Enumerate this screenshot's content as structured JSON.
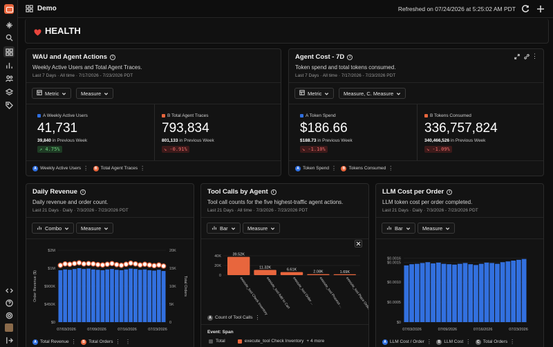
{
  "app": {
    "title": "Demo",
    "refreshed": "Refreshed on 07/24/2026 at 5:25:02 AM PDT"
  },
  "dashboard": {
    "section_title": "HEALTH"
  },
  "wau": {
    "title": "WAU and Agent Actions",
    "desc": "Weekly Active Users and Total Agent Traces.",
    "meta": "Last 7 Days · All time · 7/17/2026 - 7/23/2026 PDT",
    "btn_metric": "Metric",
    "btn_measure": "Measure",
    "a_label": "A Weekly Active Users",
    "a_value": "41,731",
    "a_prev_num": "39,840",
    "a_prev_text": " in Previous Week",
    "a_delta": "↗ 4.75%",
    "b_label": "B Total Agent Traces",
    "b_value": "793,834",
    "b_prev_num": "801,133",
    "b_prev_text": " in Previous Week",
    "b_delta": "↘ -0.91%",
    "legend_a": "Weekly Active Users",
    "legend_b": "Total Agent Traces"
  },
  "cost": {
    "title": "Agent Cost - 7D",
    "desc": "Token spend and total tokens consumed.",
    "meta": "Last 7 Days · All time · 7/17/2026 - 7/23/2026 PDT",
    "btn_metric": "Metric",
    "btn_measure": "Measure, C. Measure",
    "a_label": "A Token Spend",
    "a_value": "$186.66",
    "a_prev_num": "$188.73",
    "a_prev_text": " in Previous Week",
    "a_delta": "↘ -1.10%",
    "b_label": "B Tokens Consumed",
    "b_value": "336,757,824",
    "b_prev_num": "340,466,526",
    "b_prev_text": " in Previous Week",
    "b_delta": "↘ -1.09%",
    "legend_a": "Token Spend",
    "legend_b": "Tokens Consumed"
  },
  "revenue": {
    "title": "Daily Revenue",
    "desc": "Daily revenue and order count.",
    "meta": "Last 21 Days · Daily · 7/3/2026 - 7/23/2026 PDT",
    "btn_type": "Combo",
    "btn_measure": "Measure",
    "legend_a": "Total Revenue",
    "legend_b": "Total Orders",
    "y_left_title": "Order Revenue ($)",
    "y_right_title": "Total Orders"
  },
  "toolcalls": {
    "title": "Tool Calls by Agent",
    "desc": "Tool call counts for the five highest-traffic agent actions.",
    "meta": "Last 21 Days · All time · 7/3/2026 - 7/23/2026 PDT",
    "btn_type": "Bar",
    "btn_measure": "Measure",
    "legend_a": "Count of Tool Calls",
    "event_label": "Event: Span",
    "event_total": "Total",
    "event_item": "execute_tool Check Inventory",
    "event_more": "+ 4 more"
  },
  "llmcost": {
    "title": "LLM Cost per Order",
    "desc": "LLM token cost per order completed.",
    "meta": "Last 21 Days · Daily · 7/3/2026 - 7/23/2026 PDT",
    "btn_type": "Bar",
    "btn_measure": "Measure",
    "legend_a": "LLM Cost / Order",
    "legend_b": "LLM Cost",
    "legend_c": "Total Orders"
  },
  "colors": {
    "blue": "#2f6fe0",
    "orange": "#e8663d",
    "bar_blue": "#3270df"
  },
  "chart_data": [
    {
      "type": "combo",
      "title": "Daily Revenue",
      "ylabel": "Order Revenue ($)",
      "y2label": "Total Orders",
      "ylim": [
        0,
        1800000
      ],
      "y2lim": [
        0,
        20000
      ],
      "y_ticks": [
        "$0",
        "$450K",
        "$900K",
        "$1M",
        "$2M"
      ],
      "y2_ticks": [
        "0",
        "5K",
        "10K",
        "15K",
        "20K"
      ],
      "x_ticks": [
        "07/03/2026",
        "07/09/2026",
        "07/16/2026",
        "07/23/2026"
      ],
      "series": [
        {
          "name": "Total Revenue",
          "type": "bar",
          "values": [
            1300000,
            1320000,
            1310000,
            1330000,
            1350000,
            1330000,
            1340000,
            1320000,
            1310000,
            1300000,
            1320000,
            1330000,
            1310000,
            1300000,
            1320000,
            1340000,
            1330000,
            1310000,
            1320000,
            1300000,
            1290000,
            1310000,
            1280000
          ]
        },
        {
          "name": "Total Orders",
          "type": "line",
          "values": [
            15800,
            16200,
            16100,
            16300,
            16500,
            16200,
            16300,
            16200,
            16000,
            15900,
            16100,
            16300,
            16000,
            15800,
            16100,
            16400,
            16200,
            15900,
            16100,
            15900,
            15700,
            15900,
            15600
          ]
        }
      ]
    },
    {
      "type": "bar",
      "title": "Tool Calls by Agent",
      "categories": [
        "execute_tool Check Inventory",
        "execute_tool Add to Cart",
        "execute_tool Order ...",
        "execute_tool Process ...",
        "execute_tool Place Order"
      ],
      "values": [
        39520,
        11320,
        6610,
        2080,
        1690
      ],
      "data_labels": [
        "39.52K",
        "11.32K",
        "6.61K",
        "2.08K",
        "1.69K"
      ],
      "y_ticks": [
        "0",
        "20K",
        "40K"
      ],
      "ylim": [
        0,
        45000
      ]
    },
    {
      "type": "bar",
      "title": "LLM Cost per Order",
      "ylim": [
        0,
        0.0018
      ],
      "y_ticks": [
        "$0",
        "$0.0005",
        "$0.0010",
        "$0.0015",
        "$0.0016"
      ],
      "x_ticks": [
        "07/03/2026",
        "07/09/2026",
        "07/16/2026",
        "07/23/2026"
      ],
      "series": [
        {
          "name": "LLM Cost / Order",
          "values": [
            0.00142,
            0.00145,
            0.00146,
            0.00148,
            0.0015,
            0.00147,
            0.00149,
            0.00146,
            0.00145,
            0.00144,
            0.00146,
            0.00148,
            0.00145,
            0.00143,
            0.00146,
            0.00149,
            0.00148,
            0.00146,
            0.0015,
            0.00152,
            0.00154,
            0.00156,
            0.00158
          ]
        }
      ]
    }
  ]
}
